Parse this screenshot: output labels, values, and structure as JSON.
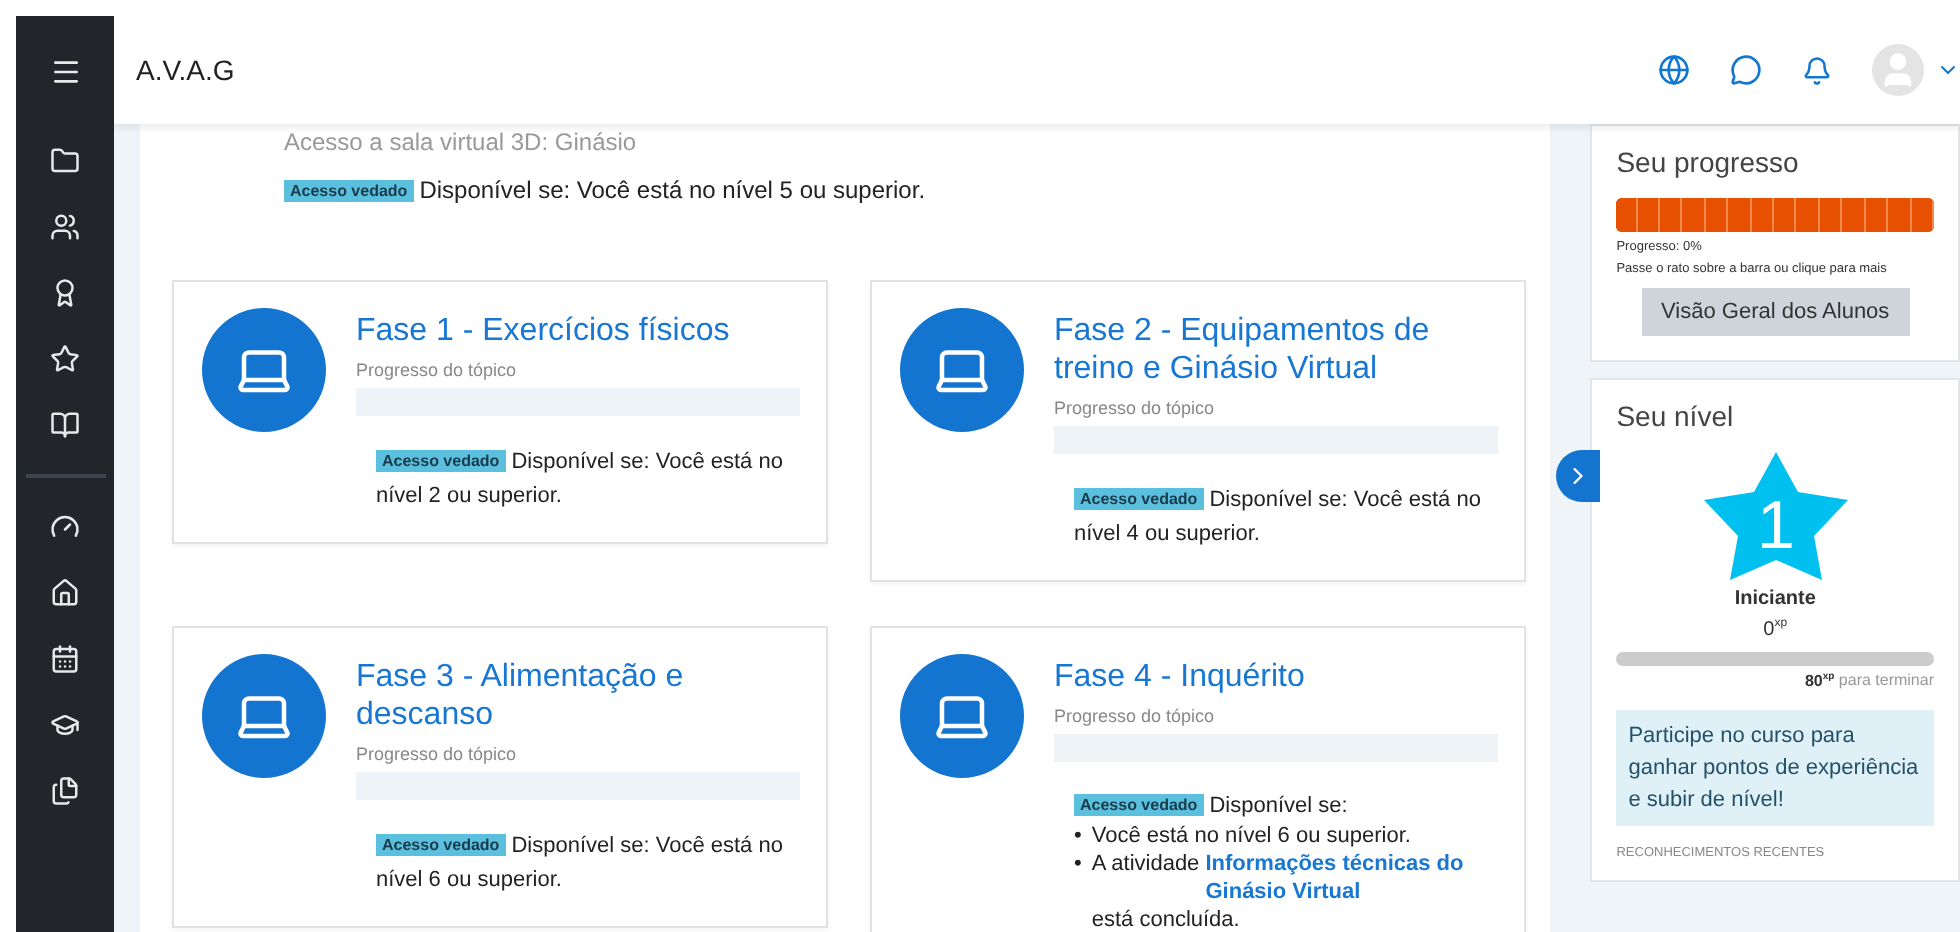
{
  "header": {
    "site_name": "A.V.A.G"
  },
  "top_activity": {
    "name": "Acesso a sala virtual 3D: Ginásio",
    "badge": "Acesso vedado",
    "restriction": "Disponível se: Você está no nível 5 ou superior."
  },
  "sections": [
    {
      "title": "Fase 1 - Exercícios físicos",
      "progress_label": "Progresso do tópico",
      "badge": "Acesso vedado",
      "kind": "text",
      "restriction": "Disponível se: Você está no nível 2 ou superior."
    },
    {
      "title": "Fase 2 - Equipamentos de treino e Ginásio Virtual",
      "progress_label": "Progresso do tópico",
      "badge": "Acesso vedado",
      "kind": "text",
      "restriction": "Disponível se: Você está no nível 4 ou superior."
    },
    {
      "title": "Fase 3 - Alimentação e descanso",
      "progress_label": "Progresso do tópico",
      "badge": "Acesso vedado",
      "kind": "text",
      "restriction": "Disponível se: Você está no nível 6 ou superior."
    },
    {
      "title": "Fase 4 - Inquérito",
      "progress_label": "Progresso do tópico",
      "badge": "Acesso vedado",
      "kind": "list",
      "restriction": "Disponível se:",
      "conditions": [
        {
          "marker": "•",
          "text": "Você está no nível 6 ou superior."
        },
        {
          "marker": "•",
          "before": "A atividade ",
          "link": "Informações técnicas do Ginásio Virtual",
          "after": " está concluída."
        }
      ]
    }
  ],
  "progress_block": {
    "title": "Seu progresso",
    "progress_text": "Progresso: 0%",
    "hint": "Passe o rato sobre a barra ou clique para mais",
    "button": "Visão Geral dos Alunos"
  },
  "level_block": {
    "title": "Seu nível",
    "level_number": "1",
    "level_name": "Iniciante",
    "xp": "0",
    "xp_unit": "xp",
    "level": 0,
    "remaining": "80",
    "remaining_unit": "xp",
    "remaining_label": "para terminar",
    "info": "Participe no curso para ganhar pontos de experiência e subir de nível!",
    "recent_heading": "RECONHECIMENTOS RECENTES"
  }
}
